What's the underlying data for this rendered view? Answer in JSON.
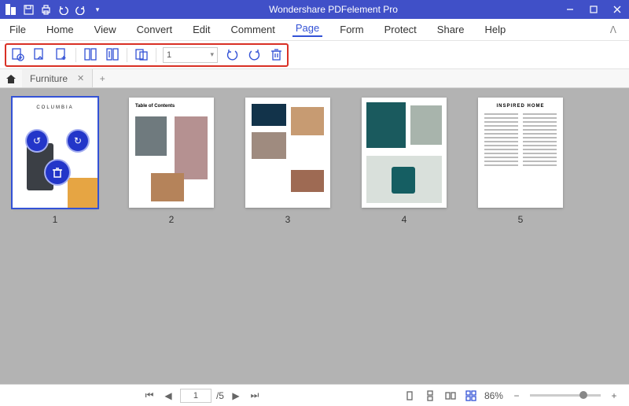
{
  "app": {
    "title": "Wondershare PDFelement Pro"
  },
  "menu": {
    "items": [
      "File",
      "Home",
      "View",
      "Convert",
      "Edit",
      "Comment",
      "Page",
      "Form",
      "Protect",
      "Share",
      "Help"
    ],
    "active": "Page"
  },
  "toolbar": {
    "page_input": "1",
    "icons": {
      "insert": "insert-page-icon",
      "extract": "extract-page-icon",
      "extract2": "extract-page2-icon",
      "split": "split-page-icon",
      "split2": "split-page2-icon",
      "replace": "replace-page-icon",
      "rotate_left": "rotate-left-icon",
      "rotate_right": "rotate-right-icon",
      "delete": "delete-page-icon"
    }
  },
  "tabs": {
    "document_name": "Furniture"
  },
  "thumbnails": {
    "pages": [
      {
        "num": "1",
        "selected": true,
        "title": "COLUMBIA"
      },
      {
        "num": "2",
        "selected": false,
        "title": "Table of Contents"
      },
      {
        "num": "3",
        "selected": false
      },
      {
        "num": "4",
        "selected": false
      },
      {
        "num": "5",
        "selected": false,
        "title": "INSPIRED HOME"
      }
    ]
  },
  "status": {
    "current_page": "1",
    "page_total_label": "/5",
    "zoom_label": "86%"
  }
}
